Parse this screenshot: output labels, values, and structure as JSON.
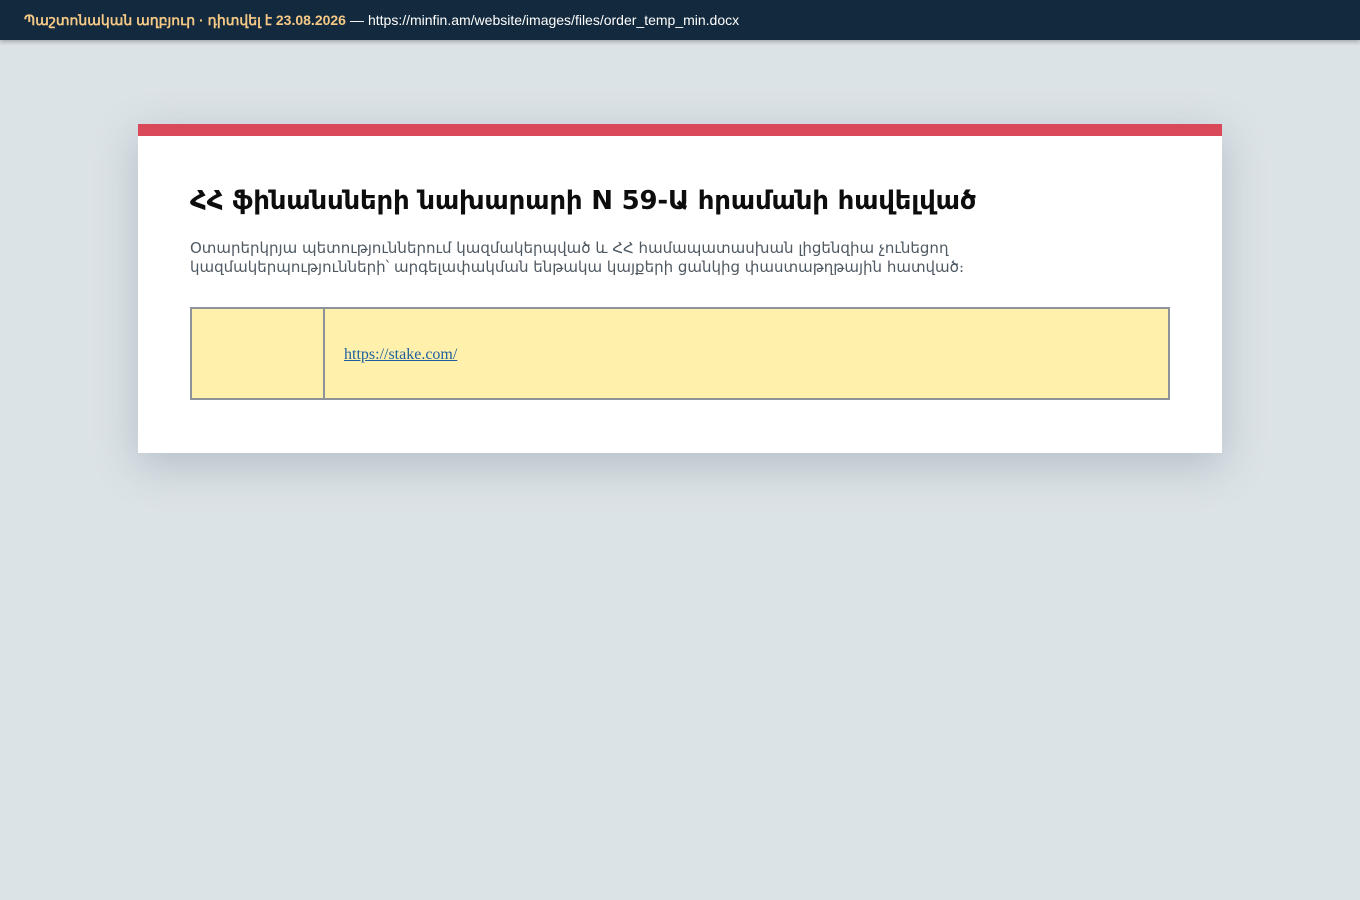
{
  "topbar": {
    "source_label": "Պաշտոնական աղբյուր · դիտվել է 23.08.2026",
    "separator": "—",
    "url": "https://minfin.am/website/images/files/order_temp_min.docx"
  },
  "document": {
    "title": "ՀՀ ֆինանսների նախարարի N 59-Ա հրամանի հավելված",
    "subtitle": "Օտարերկրյա պետություններում կազմակերպված և ՀՀ համապատասխան լիցենզիա չունեցող կազմակերպությունների՝ արգելափակման ենթակա կայքերի ցանկից փաստաթղթային հատված։",
    "table": {
      "rows": [
        {
          "number": "",
          "link": "https://stake.com/"
        }
      ]
    }
  },
  "colors": {
    "topbar_bg": "#13293d",
    "source_text": "#f6c987",
    "accent": "#d9495a",
    "table_bg": "#fff0ab",
    "link": "#1f5f9e",
    "page_bg": "#dce3e7"
  }
}
